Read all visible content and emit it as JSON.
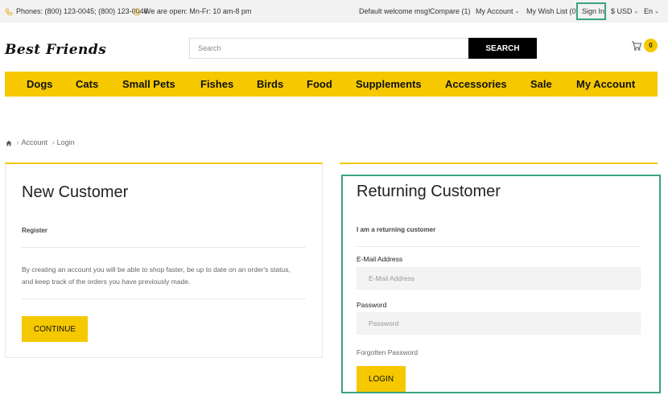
{
  "topbar": {
    "phones": "Phones: (800) 123-0045; (800) 123-0046",
    "hours": "We are open: Mn-Fr: 10 am-8 pm",
    "welcome": "Default welcome msg!",
    "compare": "Compare (1)",
    "my_account": "My Account",
    "wishlist": "My Wish List (0)",
    "sign_in": "Sign In",
    "currency": "$ USD",
    "language": "En"
  },
  "header": {
    "logo": "Best Friends",
    "search_placeholder": "Search",
    "search_button": "SEARCH",
    "cart_count": "0"
  },
  "nav": {
    "items": [
      "Dogs",
      "Cats",
      "Small Pets",
      "Fishes",
      "Birds",
      "Food",
      "Supplements",
      "Accessories",
      "Sale",
      "My Account"
    ]
  },
  "breadcrumb": {
    "items": [
      "Account",
      "Login"
    ]
  },
  "new_customer": {
    "title": "New Customer",
    "subtitle": "Register",
    "text": "By creating an account you will be able to shop faster, be up to date on an order's status, and keep track of the orders you have previously made.",
    "button": "CONTINUE"
  },
  "returning_customer": {
    "title": "Returning Customer",
    "subtitle": "I am a returning customer",
    "email_label": "E-Mail Address",
    "email_placeholder": "E-Mail Address",
    "password_label": "Password",
    "password_placeholder": "Password",
    "forgotten": "Forgotten Password",
    "button": "LOGIN"
  },
  "colors": {
    "accent": "#f5c800",
    "highlight": "#3aa382",
    "topbar_bg": "#f2f2f2"
  }
}
